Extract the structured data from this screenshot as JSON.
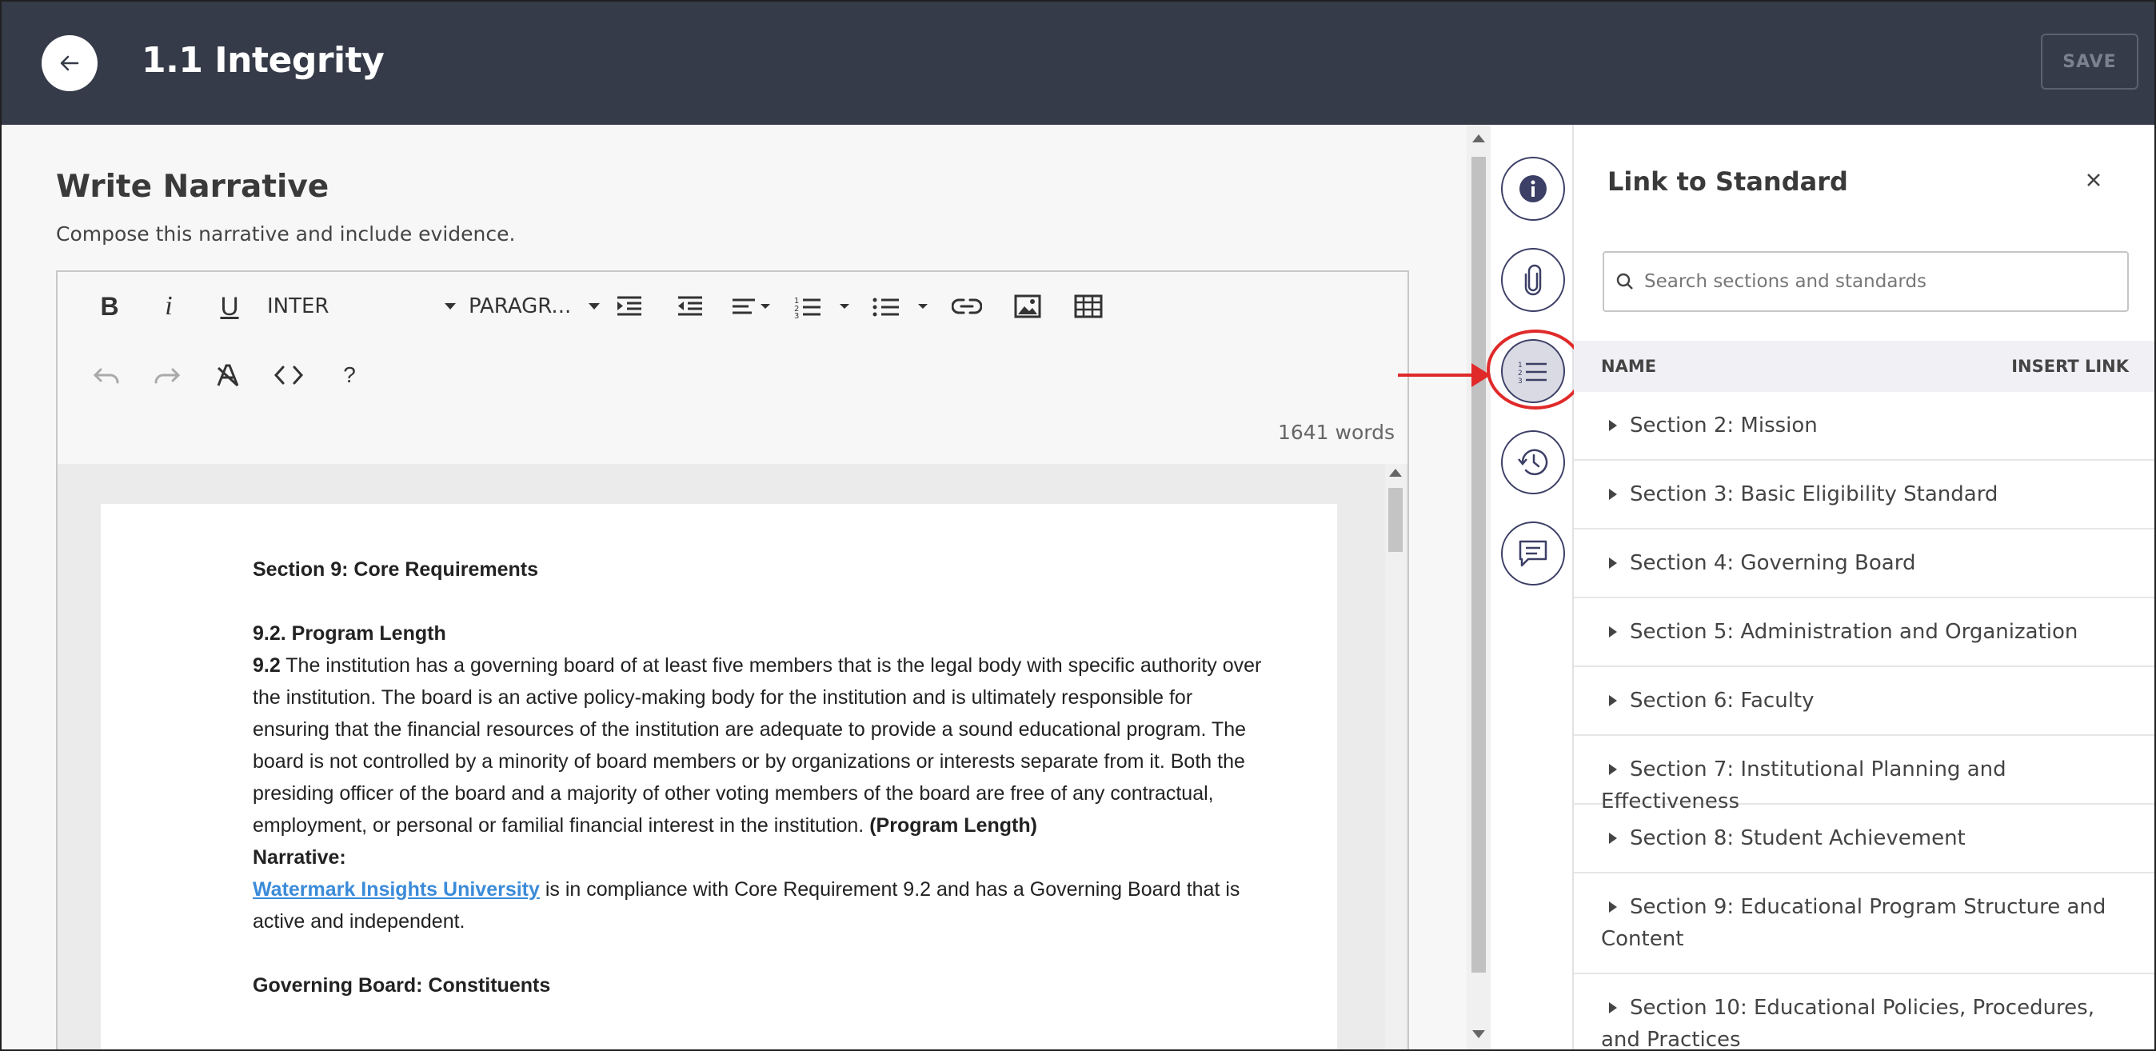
{
  "header": {
    "title": "1.1 Integrity",
    "save_label": "SAVE"
  },
  "editor": {
    "title": "Write Narrative",
    "subtitle": "Compose this narrative and include evidence.",
    "toolbar": {
      "font_select": "INTER",
      "paragraph_select": "PARAGR...",
      "help": "?"
    },
    "word_count": "1641 words",
    "document": {
      "heading": "Section 9: Core Requirements",
      "sub_heading": "9.2. Program Length",
      "para_number": "9.2",
      "para_text": "The institution has a governing board of at least five members that is the legal body with specific authority over the institution. The board is an active policy-making body for the institution and is ultimately responsible for ensuring that the financial resources of the institution are adequate to provide a sound educational program. The board is not controlled by a minority of board members or by organizations or interests separate from it. Both the presiding officer of the board and a majority of other voting members of the board are free of any contractual, employment, or personal or familial financial interest in the institution.",
      "para_tail": "(Program Length)",
      "narrative_label": "Narrative:",
      "link_text": "Watermark Insights University",
      "narrative_text": "is in compliance with Core Requirement 9.2 and has a Governing Board that is active and independent.",
      "section_heading": "Governing Board: Constituents"
    }
  },
  "panel": {
    "title": "Link to Standard",
    "search_placeholder": "Search sections and standards",
    "col_name": "NAME",
    "col_link": "INSERT LINK",
    "items": [
      {
        "label": "Section 2: Mission"
      },
      {
        "label": "Section 3: Basic Eligibility Standard"
      },
      {
        "label": "Section 4: Governing Board"
      },
      {
        "label": "Section 5: Administration and Organization"
      },
      {
        "label": "Section 6: Faculty"
      },
      {
        "label": "Section 7: Institutional Planning and Effectiveness"
      },
      {
        "label": "Section 8: Student Achievement"
      },
      {
        "label": "Section 9: Educational Program Structure and Content"
      },
      {
        "label": "Section 10: Educational Policies, Procedures, and Practices"
      }
    ]
  },
  "colors": {
    "header_bg": "#363b49",
    "accent": "#3c3f66",
    "annotation": "#e02a2a",
    "link": "#3b8bd9"
  }
}
